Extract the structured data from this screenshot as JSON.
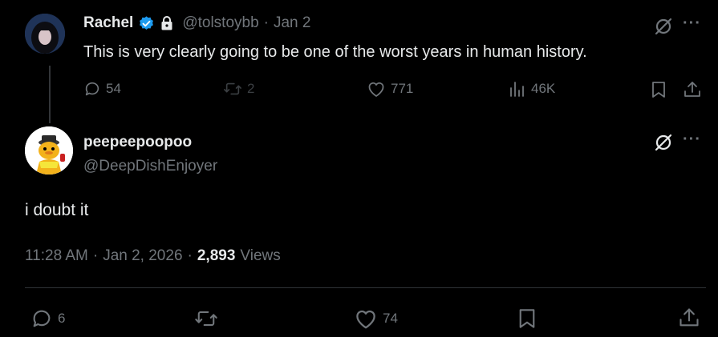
{
  "parent_tweet": {
    "author_name": "Rachel",
    "handle": "@tolstoybb",
    "date_sep": "·",
    "date": "Jan 2",
    "text": "This is very clearly going to be one of the worst years in human history.",
    "replies": "54",
    "reposts": "2",
    "likes": "771",
    "views": "46K"
  },
  "main_tweet": {
    "author_name": "peepeepoopoo",
    "handle": "@DeepDishEnjoyer",
    "text": "i doubt it",
    "time": "11:28 AM",
    "sep1": "·",
    "date": "Jan 2, 2026",
    "sep2": "·",
    "view_count": "2,893",
    "views_label": "Views",
    "replies": "6",
    "likes": "74"
  },
  "icons": {
    "verified": "verified-badge-icon",
    "lock": "lock-icon",
    "grok": "grok-icon",
    "more": "more-icon",
    "reply": "reply-icon",
    "repost": "repost-icon",
    "like": "heart-icon",
    "views": "views-icon",
    "bookmark": "bookmark-icon",
    "share": "share-icon"
  },
  "colors": {
    "background": "#000000",
    "text": "#e7e9ea",
    "muted": "#71767b",
    "verified": "#1d9bf0",
    "divider": "#2f3336"
  }
}
